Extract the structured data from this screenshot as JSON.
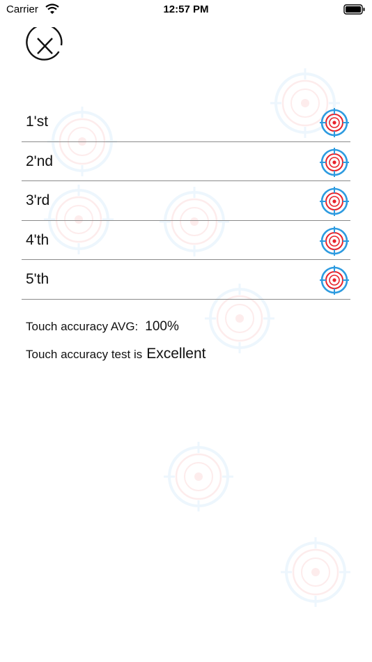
{
  "status_bar": {
    "carrier": "Carrier",
    "time": "12:57 PM"
  },
  "icons": {
    "close": "close-icon",
    "target": "target-icon",
    "wifi": "wifi-icon",
    "battery": "battery-icon"
  },
  "colors": {
    "target_blue": "#2d9be0",
    "target_red": "#e8232b",
    "divider": "#8a8a8a"
  },
  "taps": [
    {
      "label": "1'st"
    },
    {
      "label": "2'nd"
    },
    {
      "label": "3'rd"
    },
    {
      "label": "4'th"
    },
    {
      "label": "5'th"
    }
  ],
  "results": {
    "avg_label": "Touch accuracy AVG:",
    "avg_value": "100%",
    "rating_label": "Touch accuracy test is",
    "rating_value": "Excellent"
  }
}
